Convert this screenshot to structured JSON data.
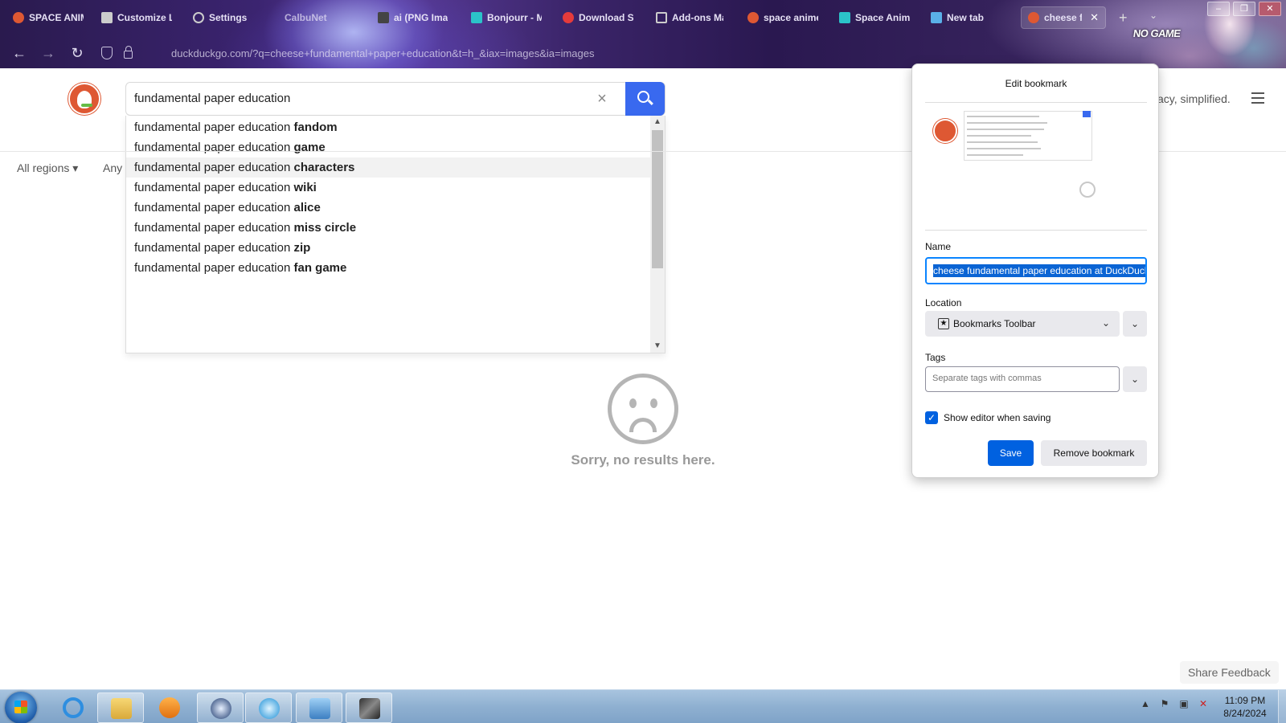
{
  "browser": {
    "tabs": [
      {
        "label": "SPACE ANIM",
        "icon": "ddg-icon"
      },
      {
        "label": "Customize L",
        "icon": "brush-icon"
      },
      {
        "label": "Settings",
        "icon": "gear-icon"
      },
      {
        "label": "CalbuNet",
        "icon": "blank-icon"
      },
      {
        "label": "ai (PNG Ima",
        "icon": "image-icon"
      },
      {
        "label": "Bonjourr - M",
        "icon": "bonjourr-icon"
      },
      {
        "label": "Download Sc",
        "icon": "download-icon"
      },
      {
        "label": "Add-ons Ma",
        "icon": "puzzle-icon"
      },
      {
        "label": "space anime",
        "icon": "ddg-icon"
      },
      {
        "label": "Space Anima",
        "icon": "bonjourr-icon"
      },
      {
        "label": "New tab",
        "icon": "newtab-icon"
      },
      {
        "label": "cheese fun",
        "icon": "ddg-icon",
        "active": true
      }
    ],
    "new_tab_glyph": "+",
    "list_tabs_glyph": "⌄",
    "theme_text": "NO GAME",
    "url": "duckduckgo.com/?q=cheese+fundamental+paper+education&t=h_&iax=images&ia=images",
    "window_buttons": [
      "–",
      "❐",
      "✕"
    ]
  },
  "ddg": {
    "search_query": "fundamental paper education",
    "clear_glyph": "×",
    "tagline": "acy, simplified.",
    "suggestions": [
      {
        "base": "fundamental paper education ",
        "bold": "fandom"
      },
      {
        "base": "fundamental paper education ",
        "bold": "game"
      },
      {
        "base": "fundamental paper education ",
        "bold": "characters"
      },
      {
        "base": "fundamental paper education ",
        "bold": "wiki"
      },
      {
        "base": "fundamental paper education ",
        "bold": "alice"
      },
      {
        "base": "fundamental paper education ",
        "bold": "miss circle"
      },
      {
        "base": "fundamental paper education ",
        "bold": "zip"
      },
      {
        "base": "fundamental paper education ",
        "bold": "fan game"
      }
    ],
    "hovered_index": 2,
    "filters": {
      "region": "All regions ▾",
      "time": "Any"
    },
    "no_results": "Sorry, no results here.",
    "share_feedback": "Share Feedback"
  },
  "bookmark_panel": {
    "title": "Edit bookmark",
    "name_label": "Name",
    "name_value": "cheese fundamental paper education at DuckDuckGo",
    "location_label": "Location",
    "location_value": "Bookmarks Toolbar",
    "tags_label": "Tags",
    "tags_placeholder": "Separate tags with commas",
    "show_editor_label": "Show editor when saving",
    "show_editor_checked": true,
    "save_label": "Save",
    "remove_label": "Remove bookmark"
  },
  "taskbar": {
    "apps": [
      "internet-explorer-icon",
      "file-explorer-icon",
      "media-player-icon",
      "browser-globe-icon",
      "app-circle-icon",
      "control-panel-icon",
      "game-thumbnail-icon"
    ],
    "time": "11:09 PM",
    "date": "8/24/2024"
  },
  "colors": {
    "accent_blue": "#3969ef",
    "firefox_blue": "#0061e0",
    "ddg_orange": "#de5833"
  }
}
